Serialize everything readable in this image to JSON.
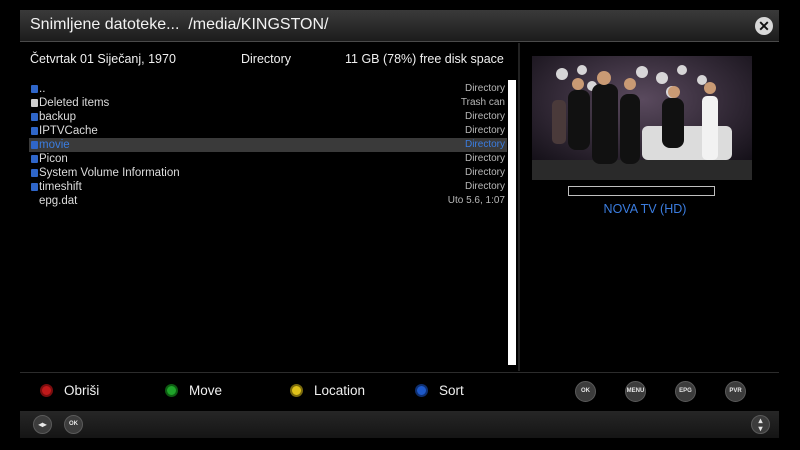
{
  "title_bar": {
    "title": "Snimljene datoteke...  /media/KINGSTON/",
    "close_icon": "close-icon"
  },
  "info": {
    "date": "Četvrtak 01 Siječanj, 1970",
    "type": "Directory",
    "free_space": "11 GB (78%) free disk space"
  },
  "list": {
    "items": [
      {
        "name": "..",
        "kind": "Directory",
        "icon": "folder-icon",
        "selected": false
      },
      {
        "name": "Deleted items",
        "kind": "Trash can",
        "icon": "trash-icon",
        "selected": false
      },
      {
        "name": "backup",
        "kind": "Directory",
        "icon": "folder-icon",
        "selected": false
      },
      {
        "name": "IPTVCache",
        "kind": "Directory",
        "icon": "folder-icon",
        "selected": false
      },
      {
        "name": "movie",
        "kind": "Directory",
        "icon": "folder-icon",
        "selected": true
      },
      {
        "name": "Picon",
        "kind": "Directory",
        "icon": "folder-icon",
        "selected": false
      },
      {
        "name": "System Volume Information",
        "kind": "Directory",
        "icon": "folder-icon",
        "selected": false
      },
      {
        "name": "timeshift",
        "kind": "Directory",
        "icon": "folder-icon",
        "selected": false
      },
      {
        "name": "epg.dat",
        "kind": "Uto 5.6, 1:07",
        "icon": "",
        "selected": false
      }
    ]
  },
  "preview": {
    "channel": "NOVA TV (HD)",
    "progress": 0,
    "channel_logo": "nova-logo"
  },
  "color_buttons": [
    {
      "label": "Obriši",
      "color": "#c0191a"
    },
    {
      "label": "Move",
      "color": "#1fa32a"
    },
    {
      "label": "Location",
      "color": "#e0c21a"
    },
    {
      "label": "Sort",
      "color": "#1d58c8"
    }
  ],
  "keys": {
    "ok": "OK",
    "menu": "MENU",
    "epg": "EPG",
    "pvr": "PVR"
  },
  "bottom": {
    "left_icon": "left-right-arrows-icon",
    "ok": "OK",
    "right_icon": "up-down-arrows-icon"
  }
}
